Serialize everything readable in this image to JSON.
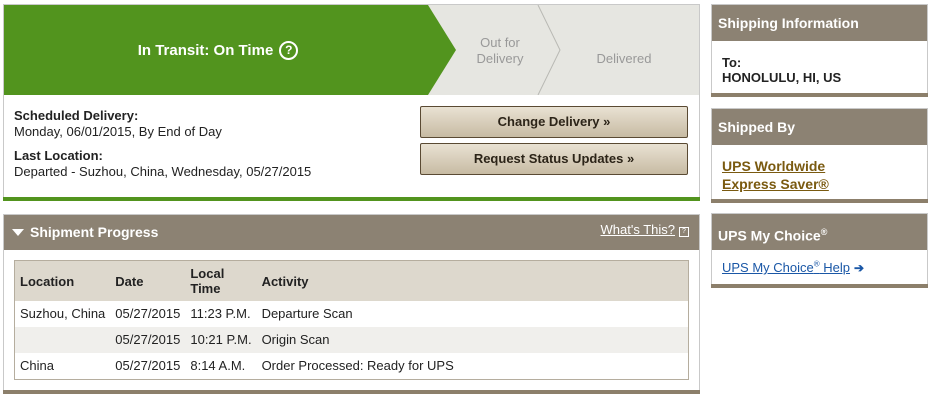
{
  "status": {
    "stages": [
      {
        "label": "In Transit: On Time",
        "state": "current"
      },
      {
        "label": "Out for Delivery",
        "state": "upcoming"
      },
      {
        "label": "Delivered",
        "state": "upcoming"
      }
    ],
    "help_glyph": "?",
    "scheduled_delivery_label": "Scheduled Delivery:",
    "scheduled_delivery_value": "Monday, 06/01/2015, By End of Day",
    "last_location_label": "Last Location:",
    "last_location_value": "Departed - Suzhou, China, Wednesday, 05/27/2015",
    "change_delivery_button": "Change Delivery »",
    "request_updates_button": "Request Status Updates »",
    "colors": {
      "active": "#52941e",
      "inactive": "#e6e6e1"
    }
  },
  "progress": {
    "title": "Shipment Progress",
    "whats_this": "What's This?",
    "columns": [
      "Location",
      "Date",
      "Local Time",
      "Activity"
    ],
    "rows": [
      {
        "location": "Suzhou, China",
        "date": "05/27/2015",
        "time": "11:23 P.M.",
        "activity": "Departure Scan"
      },
      {
        "location": "",
        "date": "05/27/2015",
        "time": "10:21 P.M.",
        "activity": "Origin Scan"
      },
      {
        "location": "China",
        "date": "05/27/2015",
        "time": "8:14 A.M.",
        "activity": "Order Processed: Ready for UPS"
      }
    ]
  },
  "sidebar": {
    "shipping_info": {
      "title": "Shipping Information",
      "to_label": "To:",
      "to_value": "HONOLULU, HI, US"
    },
    "shipped_by": {
      "title": "Shipped By",
      "service_line1": "UPS Worldwide",
      "service_line2": "Express Saver®"
    },
    "my_choice": {
      "title": "UPS My Choice",
      "title_sup": "®",
      "link_text": "UPS My Choice",
      "link_sup": "®",
      "link_suffix": " Help"
    }
  }
}
